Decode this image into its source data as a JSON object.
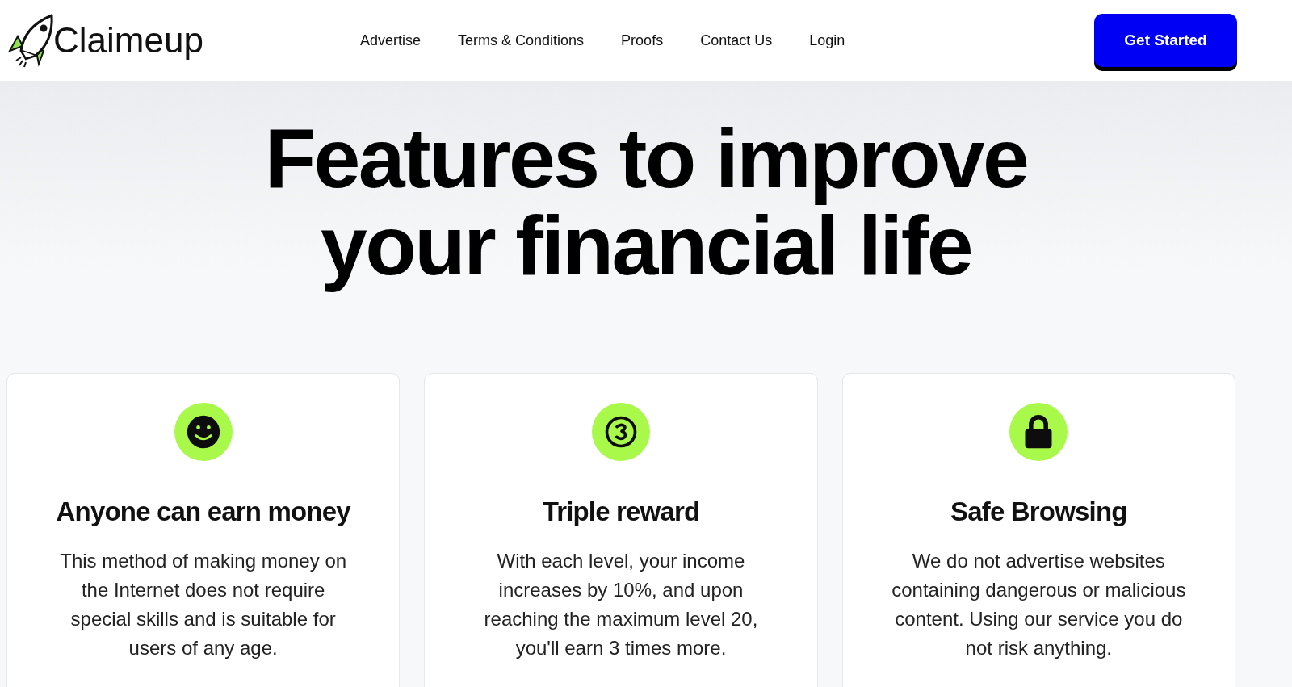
{
  "header": {
    "logo": "Claimeup",
    "nav": [
      "Advertise",
      "Terms & Conditions",
      "Proofs",
      "Contact Us",
      "Login"
    ],
    "cta": "Get Started"
  },
  "hero": {
    "title_lines": [
      "Features to improve",
      "your financial life"
    ]
  },
  "features": [
    {
      "kind": "smile",
      "title": "Anyone can earn money",
      "text": "This method of making money on the Internet does not require special skills and is suitable for users of any age."
    },
    {
      "kind": "number-three",
      "title": "Triple reward",
      "text": "With each level, your income increases by 10%, and upon reaching the maximum level 20, you'll earn 3 times more."
    },
    {
      "kind": "lock",
      "title": "Safe Browsing",
      "text": "We do not advertise websites containing dangerous or malicious content. Using our service you do not risk anything."
    }
  ]
}
